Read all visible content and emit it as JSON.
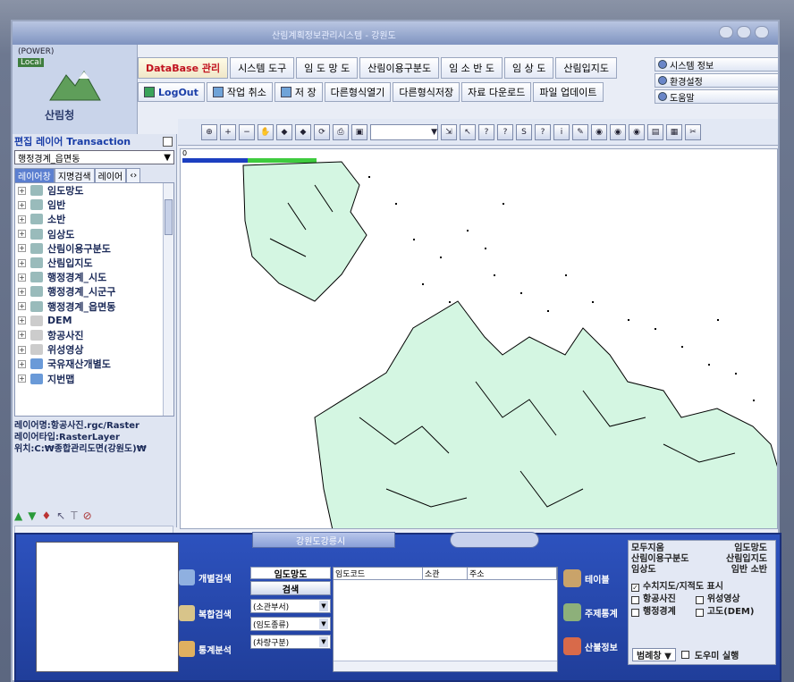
{
  "window": {
    "title": "산림계획정보관리시스템 - 강원도"
  },
  "logo": {
    "power": "(POWER)",
    "local": "Local",
    "name": "산림청"
  },
  "menu": [
    "DataBase 관리",
    "시스템 도구",
    "임 도 망 도",
    "산림이용구분도",
    "임 소 반 도",
    "임 상 도",
    "산림입지도"
  ],
  "buttons": {
    "logout": "LogOut",
    "undo": "작업 취소",
    "save": "저 장",
    "other_open": "다른형식열기",
    "other_save": "다른형식저장",
    "download": "자료 다운로드",
    "upload": "파일 업데이트"
  },
  "right_menu": [
    "시스템 정보",
    "환경설정",
    "도움말"
  ],
  "left": {
    "title": "편집 레이어 Transaction",
    "select_value": "행정경계_읍면동",
    "tabs": [
      "레이어창",
      "지명검색",
      "레이어"
    ],
    "layers": [
      "임도망도",
      "임반",
      "소반",
      "임상도",
      "산림이용구분도",
      "산림입지도",
      "행정경계_시도",
      "행정경계_시군구",
      "행정경계_읍면동",
      "DEM",
      "항공사진",
      "위성영상",
      "국유재산개별도",
      "지번맵"
    ],
    "info_name": "레이어명:항공사진.rgc/Raster",
    "info_type": "레이어타입:RasterLayer",
    "info_path": "위치:C:₩종합관리도면(강원도)₩"
  },
  "map": {
    "scale_start": "0",
    "scale_mid": "1"
  },
  "bottom": {
    "tab_title": "강원도강릉시",
    "search_btns": [
      "개별검색",
      "복합검색",
      "통계분석"
    ],
    "mid_header": "임도망도",
    "mid_go": "검색",
    "dropdowns": [
      "(소관부서)",
      "(임도종류)",
      "(차량구분)"
    ],
    "grid_cols": [
      "임도코드",
      "소관",
      "주소"
    ],
    "right_btns": [
      "테이블",
      "주제통계",
      "산불정보"
    ],
    "panel_rows": [
      [
        "모두지움",
        "임도망도"
      ],
      [
        "산림이용구분도",
        "산림입지도"
      ],
      [
        "임상도",
        "임반   소반"
      ]
    ],
    "checks": [
      "수치지도/지적도 표시",
      "항공사진",
      "위성영상",
      "행정경계",
      "고도(DEM)"
    ],
    "footer_select": "범례창 ▼",
    "footer_check": "도우미 실행"
  }
}
